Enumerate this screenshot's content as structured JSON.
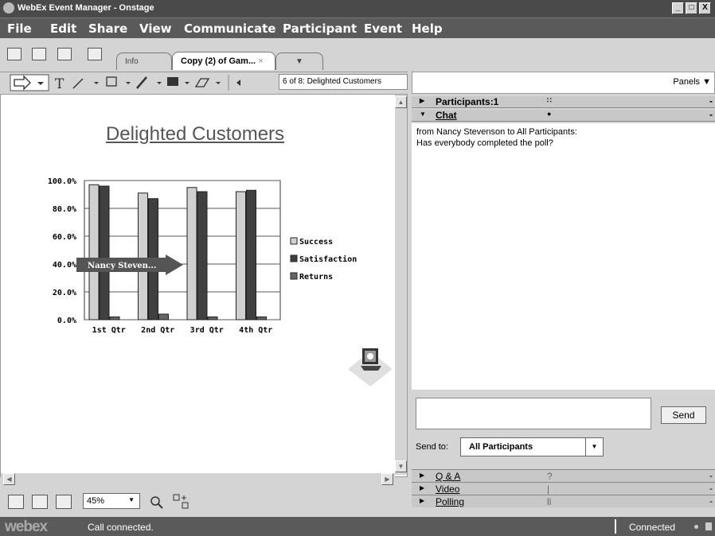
{
  "window": {
    "title": "WebEx Event Manager - Onstage",
    "controls": [
      "_",
      "°",
      "X"
    ]
  },
  "menu": [
    "File",
    "Edit",
    "Share",
    "View",
    "Communicate",
    "Participant",
    "Event",
    "Help"
  ],
  "tabs": [
    {
      "label": "Info"
    },
    {
      "label": "Copy (2) of Gam...",
      "close": "×"
    },
    {
      "label": "▼"
    }
  ],
  "slide_selector": "6 of 8: Delighted Customers",
  "panels_button": "Panels ▼",
  "slide": {
    "title": "Delighted Customers",
    "annotation": "Nancy Steven...",
    "chart_data": {
      "type": "bar",
      "categories": [
        "1st Qtr",
        "2nd Qtr",
        "3rd Qtr",
        "4th Qtr"
      ],
      "series": [
        {
          "name": "Success",
          "values": [
            97,
            91,
            95,
            92
          ],
          "color": "#d0d0d0"
        },
        {
          "name": "Satisfaction",
          "values": [
            96,
            87,
            92,
            93
          ],
          "color": "#404040"
        },
        {
          "name": "Returns",
          "values": [
            2,
            4,
            2,
            2
          ],
          "color": "#666666"
        }
      ],
      "ylim": [
        0,
        100
      ],
      "yticks": [
        "100.0%",
        "80.0%",
        "60.0%",
        "40.0%",
        "20.0%",
        "0.0%"
      ],
      "legend": "right"
    }
  },
  "zoom": "45%",
  "participants_header": "Participants:1",
  "chat_header": "Chat",
  "chat_messages": [
    "from Nancy Stevenson to All Participants:",
    "Has everybody completed the poll?"
  ],
  "send_label": "Send",
  "send_to_label": "Send to:",
  "send_to_value": "All Participants",
  "panels": [
    {
      "label": "Q & A",
      "badge": "?"
    },
    {
      "label": "Video",
      "badge": "|"
    },
    {
      "label": "Polling",
      "badge": "ll"
    }
  ],
  "status": {
    "logo": "webex",
    "message": "Call connected.",
    "connection": "Connected"
  }
}
